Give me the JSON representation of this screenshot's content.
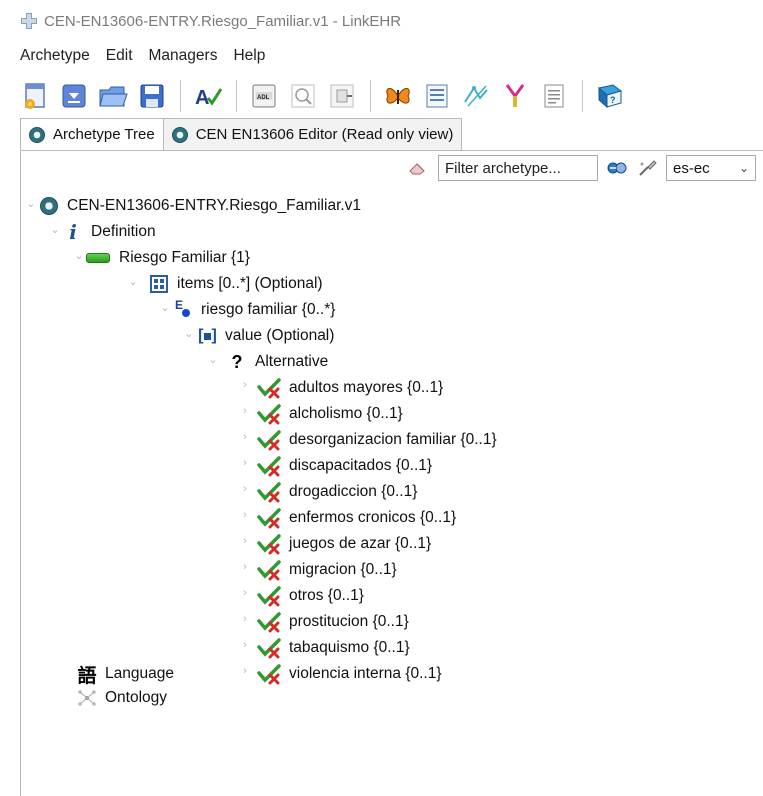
{
  "window": {
    "title": "CEN-EN13606-ENTRY.Riesgo_Familiar.v1 - LinkEHR"
  },
  "menubar": {
    "items": [
      "Archetype",
      "Edit",
      "Managers",
      "Help"
    ]
  },
  "toolbar": {
    "buttons": [
      "new-archetype",
      "import",
      "open",
      "save",
      "validate",
      "adl-view",
      "search",
      "export",
      "specialize",
      "form",
      "terminology",
      "tools",
      "document",
      "help"
    ]
  },
  "tabs": [
    {
      "label": "Archetype Tree",
      "active": true
    },
    {
      "label": "CEN EN13606 Editor (Read only view)",
      "active": false
    }
  ],
  "filter": {
    "placeholder": "Filter archetype...",
    "language": "es-ec"
  },
  "tree": {
    "root": "CEN-EN13606-ENTRY.Riesgo_Familiar.v1",
    "definition": "Definition",
    "entry": "Riesgo Familiar {1}",
    "items": "items [0..*] (Optional)",
    "element": "riesgo familiar {0..*}",
    "value": "value  (Optional)",
    "alternative": "Alternative",
    "alternatives": [
      "adultos mayores {0..1}",
      "alcholismo {0..1}",
      "desorganizacion familiar {0..1}",
      "discapacitados {0..1}",
      "drogadiccion  {0..1}",
      "enfermos cronicos  {0..1}",
      "juegos de azar {0..1}",
      "migracion  {0..1}",
      "otros {0..1}",
      "prostitucion {0..1}",
      "tabaquismo {0..1}",
      "violencia interna {0..1}"
    ],
    "language": "Language",
    "ontology": "Ontology"
  }
}
